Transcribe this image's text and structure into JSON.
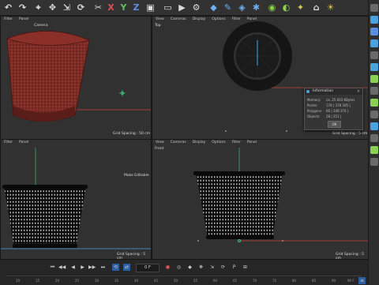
{
  "menu": {
    "filter": "Filter",
    "panel": "Panel"
  },
  "viewports": {
    "perspective": {
      "camera": "Camera",
      "grid": "Grid Spacing : 50 cm"
    },
    "top": {
      "menu": [
        "View",
        "Cameras",
        "Display",
        "Options",
        "Filter",
        "Panel"
      ],
      "title": "Top",
      "grid": "Grid Spacing : 5 cm"
    },
    "right": {
      "menu": [
        "Filter",
        "Panel"
      ],
      "make_editable": "Make Editable",
      "grid": "Grid Spacing : 5 cm"
    },
    "front": {
      "menu": [
        "View",
        "Cameras",
        "Display",
        "Options",
        "Filter",
        "Panel"
      ],
      "title": "Front",
      "grid": "Grid Spacing : 5 cm"
    }
  },
  "info_dialog": {
    "title": "Information",
    "rows": [
      {
        "label": "Memory:",
        "value": "ca. 25 603 KBytes"
      },
      {
        "label": "Points:",
        "value": "178 | 378 305 |"
      },
      {
        "label": "Polygons:",
        "value": "66 | 348 376 |"
      },
      {
        "label": "Objects:",
        "value": "28 | 251 |"
      }
    ],
    "ok": "OK"
  },
  "timeline": {
    "frame": "0 F",
    "ticks": [
      "10",
      "15",
      "20",
      "25",
      "30",
      "35",
      "40",
      "45",
      "50",
      "55",
      "60",
      "65",
      "70",
      "75",
      "80",
      "85",
      "90"
    ],
    "end_label": "90 F"
  },
  "colors": {
    "accent": "#4aa3df",
    "green_axis": "#3fbf7f",
    "red_axis": "#c94040",
    "wicker": "#7a2a24"
  }
}
